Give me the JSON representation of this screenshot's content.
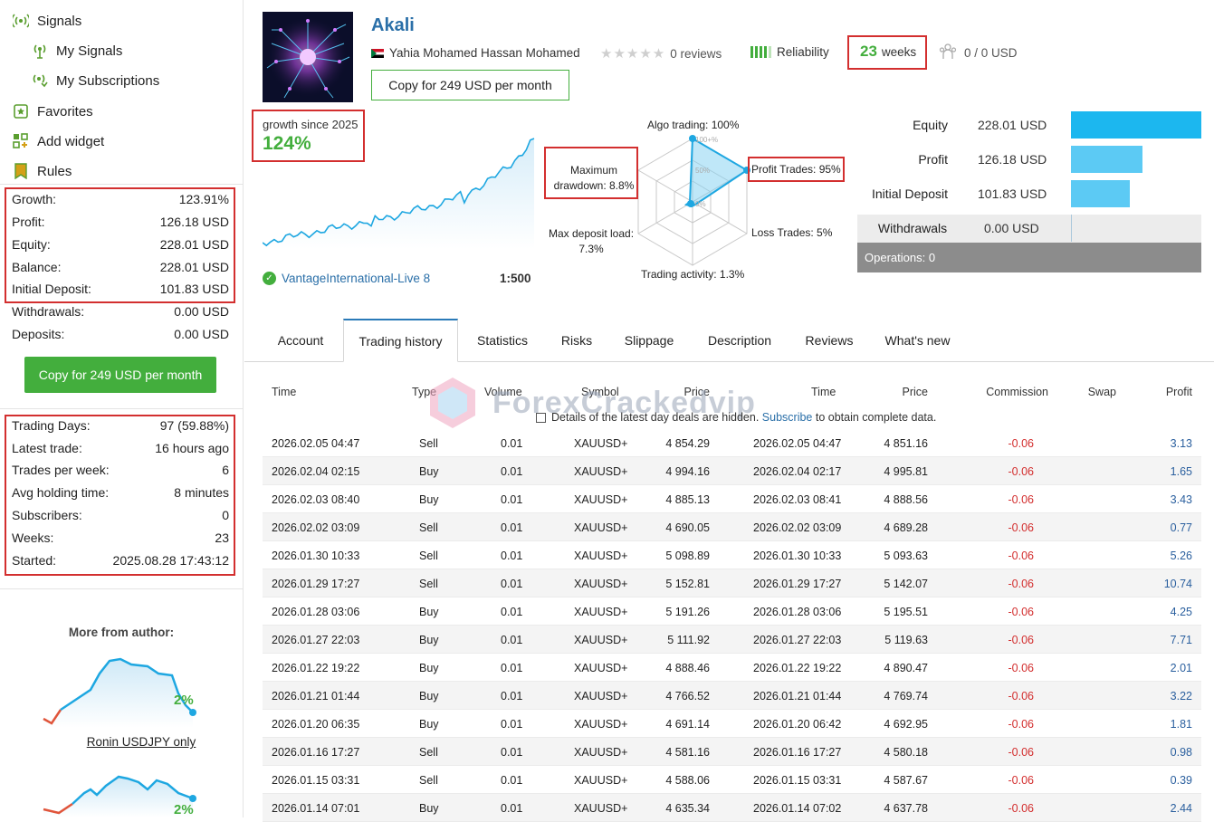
{
  "sidebar": {
    "nav": {
      "signals": "Signals",
      "my_signals": "My Signals",
      "my_subscriptions": "My Subscriptions",
      "favorites": "Favorites",
      "add_widget": "Add widget",
      "rules": "Rules"
    },
    "stats": [
      {
        "label": "Growth:",
        "value": "123.91%"
      },
      {
        "label": "Profit:",
        "value": "126.18 USD"
      },
      {
        "label": "Equity:",
        "value": "228.01 USD"
      },
      {
        "label": "Balance:",
        "value": "228.01 USD"
      },
      {
        "label": "Initial Deposit:",
        "value": "101.83 USD"
      },
      {
        "label": "Withdrawals:",
        "value": "0.00 USD"
      },
      {
        "label": "Deposits:",
        "value": "0.00 USD"
      }
    ],
    "copy_button": "Copy for 249 USD per month",
    "info": [
      {
        "label": "Trading Days:",
        "value": "97 (59.88%)"
      },
      {
        "label": "Latest trade:",
        "value": "16 hours ago"
      },
      {
        "label": "Trades per week:",
        "value": "6"
      },
      {
        "label": "Avg holding time:",
        "value": "8 minutes"
      },
      {
        "label": "Subscribers:",
        "value": "0"
      },
      {
        "label": "Weeks:",
        "value": "23"
      },
      {
        "label": "Started:",
        "value": "2025.08.28 17:43:12"
      }
    ],
    "more_from_author": "More from author:",
    "author_signals": [
      {
        "pct": "2%",
        "name": "Ronin USDJPY only"
      },
      {
        "pct": "2%",
        "name": ""
      }
    ]
  },
  "header": {
    "name": "Akali",
    "author": "Yahia Mohamed Hassan Mohamed",
    "reviews": "0 reviews",
    "reliability": "Reliability",
    "weeks_num": "23",
    "weeks_label": "weeks",
    "subscribers_usd": "0 / 0 USD",
    "copy_button": "Copy for 249 USD per month"
  },
  "growth": {
    "label": "growth since 2025",
    "value": "124%",
    "broker": "VantageInternational-Live 8",
    "leverage": "1:500"
  },
  "radar": {
    "algo": "Algo trading: 100%",
    "center_100": "100+%",
    "center_50": "50%",
    "center_0": "0%",
    "max_dd": "Maximum drawdown: 8.8%",
    "profit_trades": "Profit Trades: 95%",
    "max_dep_load": "Max deposit load: 7.3%",
    "loss_trades": "Loss Trades: 5%",
    "activity": "Trading activity: 1.3%"
  },
  "balance_bars": [
    {
      "label": "Equity",
      "value": "228.01 USD",
      "frac": 1.0,
      "color": "#1cb7ef"
    },
    {
      "label": "Profit",
      "value": "126.18 USD",
      "frac": 0.55,
      "color": "#5ccaf4"
    },
    {
      "label": "Initial Deposit",
      "value": "101.83 USD",
      "frac": 0.45,
      "color": "#5ccaf4"
    },
    {
      "label": "Withdrawals",
      "value": "0.00 USD",
      "frac": 0.0,
      "color": "#5ccaf4"
    }
  ],
  "operations": "Operations: 0",
  "tabs": [
    "Account",
    "Trading history",
    "Statistics",
    "Risks",
    "Slippage",
    "Description",
    "Reviews",
    "What's new"
  ],
  "table": {
    "headers": [
      "Time",
      "Type",
      "Volume",
      "Symbol",
      "Price",
      "Time",
      "Price",
      "Commission",
      "Swap",
      "Profit"
    ],
    "notice_before": "Details of the latest day deals are hidden.",
    "notice_link": "Subscribe",
    "notice_after": "to obtain complete data.",
    "watermark": "ForexCrackedvip",
    "rows": [
      [
        "2026.02.05 04:47",
        "Sell",
        "0.01",
        "XAUUSD+",
        "4 854.29",
        "2026.02.05 04:47",
        "4 851.16",
        "-0.06",
        "",
        "3.13"
      ],
      [
        "2026.02.04 02:15",
        "Buy",
        "0.01",
        "XAUUSD+",
        "4 994.16",
        "2026.02.04 02:17",
        "4 995.81",
        "-0.06",
        "",
        "1.65"
      ],
      [
        "2026.02.03 08:40",
        "Buy",
        "0.01",
        "XAUUSD+",
        "4 885.13",
        "2026.02.03 08:41",
        "4 888.56",
        "-0.06",
        "",
        "3.43"
      ],
      [
        "2026.02.02 03:09",
        "Sell",
        "0.01",
        "XAUUSD+",
        "4 690.05",
        "2026.02.02 03:09",
        "4 689.28",
        "-0.06",
        "",
        "0.77"
      ],
      [
        "2026.01.30 10:33",
        "Sell",
        "0.01",
        "XAUUSD+",
        "5 098.89",
        "2026.01.30 10:33",
        "5 093.63",
        "-0.06",
        "",
        "5.26"
      ],
      [
        "2026.01.29 17:27",
        "Sell",
        "0.01",
        "XAUUSD+",
        "5 152.81",
        "2026.01.29 17:27",
        "5 142.07",
        "-0.06",
        "",
        "10.74"
      ],
      [
        "2026.01.28 03:06",
        "Buy",
        "0.01",
        "XAUUSD+",
        "5 191.26",
        "2026.01.28 03:06",
        "5 195.51",
        "-0.06",
        "",
        "4.25"
      ],
      [
        "2026.01.27 22:03",
        "Buy",
        "0.01",
        "XAUUSD+",
        "5 111.92",
        "2026.01.27 22:03",
        "5 119.63",
        "-0.06",
        "",
        "7.71"
      ],
      [
        "2026.01.22 19:22",
        "Buy",
        "0.01",
        "XAUUSD+",
        "4 888.46",
        "2026.01.22 19:22",
        "4 890.47",
        "-0.06",
        "",
        "2.01"
      ],
      [
        "2026.01.21 01:44",
        "Buy",
        "0.01",
        "XAUUSD+",
        "4 766.52",
        "2026.01.21 01:44",
        "4 769.74",
        "-0.06",
        "",
        "3.22"
      ],
      [
        "2026.01.20 06:35",
        "Buy",
        "0.01",
        "XAUUSD+",
        "4 691.14",
        "2026.01.20 06:42",
        "4 692.95",
        "-0.06",
        "",
        "1.81"
      ],
      [
        "2026.01.16 17:27",
        "Sell",
        "0.01",
        "XAUUSD+",
        "4 581.16",
        "2026.01.16 17:27",
        "4 580.18",
        "-0.06",
        "",
        "0.98"
      ],
      [
        "2026.01.15 03:31",
        "Sell",
        "0.01",
        "XAUUSD+",
        "4 588.06",
        "2026.01.15 03:31",
        "4 587.67",
        "-0.06",
        "",
        "0.39"
      ],
      [
        "2026.01.14 07:01",
        "Buy",
        "0.01",
        "XAUUSD+",
        "4 635.34",
        "2026.01.14 07:02",
        "4 637.78",
        "-0.06",
        "",
        "2.44"
      ]
    ]
  },
  "colors": {
    "accent_green": "#43ae3d",
    "highlight_red": "#d32f2f",
    "link_blue": "#2a5f9e",
    "chart_blue": "#1cb7ef"
  }
}
